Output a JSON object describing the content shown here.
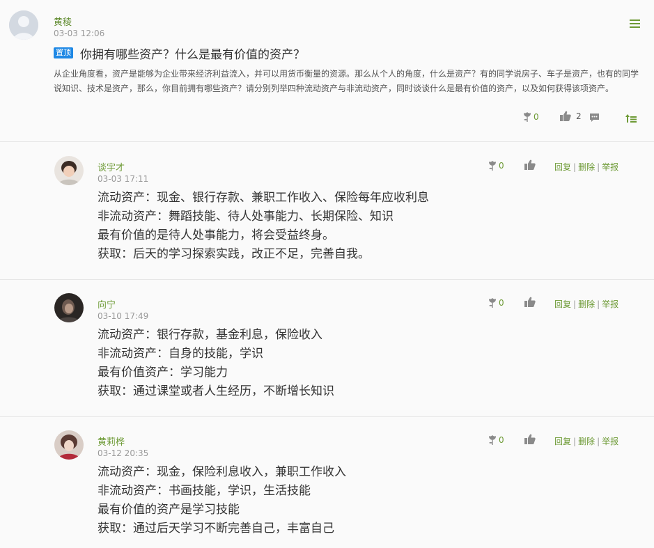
{
  "post": {
    "author": "黄稜",
    "time": "03-03 12:06",
    "pin_label": "置顶",
    "title": "你拥有哪些资产？什么是最有价值的资产？",
    "body": "从企业角度看，资产是能够为企业带来经济利益流入，并可以用货币衡量的资源。那么从个人的角度，什么是资产？有的同学说房子、车子是资产，也有的同学说知识、技术是资产，那么，你目前拥有哪些资产？请分别列举四种流动资产与非流动资产，同时谈谈什么是最有价值的资产，以及如何获得该项资产。",
    "flower_count": "0",
    "like_count": "2"
  },
  "reply_actions": {
    "reply": "回复",
    "delete": "删除",
    "report": "举报",
    "separator": "|"
  },
  "replies": [
    {
      "name": "谈宇才",
      "time": "03-03 17:11",
      "flower_count": "0",
      "lines": [
        "流动资产：现金、银行存款、兼职工作收入、保险每年应收利息",
        "非流动资产：舞蹈技能、待人处事能力、长期保险、知识",
        "最有价值的是待人处事能力，将会受益终身。",
        "获取：后天的学习探索实践，改正不足，完善自我。"
      ]
    },
    {
      "name": "向宁",
      "time": "03-10 17:49",
      "flower_count": "0",
      "lines": [
        "流动资产：银行存款，基金利息，保险收入",
        "非流动资产：自身的技能，学识",
        "最有价值资产：学习能力",
        "获取：通过课堂或者人生经历，不断增长知识"
      ]
    },
    {
      "name": "黄莉桦",
      "time": "03-12 20:35",
      "flower_count": "0",
      "lines": [
        "流动资产：现金，保险利息收入，兼职工作收入",
        "非流动资产：书画技能，学识，生活技能",
        "最有价值的资产是学习技能",
        "获取：通过后天学习不断完善自己，丰富自己"
      ]
    }
  ],
  "colors": {
    "accent_green": "#6d9a35",
    "pin_blue": "#1e88e5",
    "icon_gray": "#8a8a8a"
  }
}
